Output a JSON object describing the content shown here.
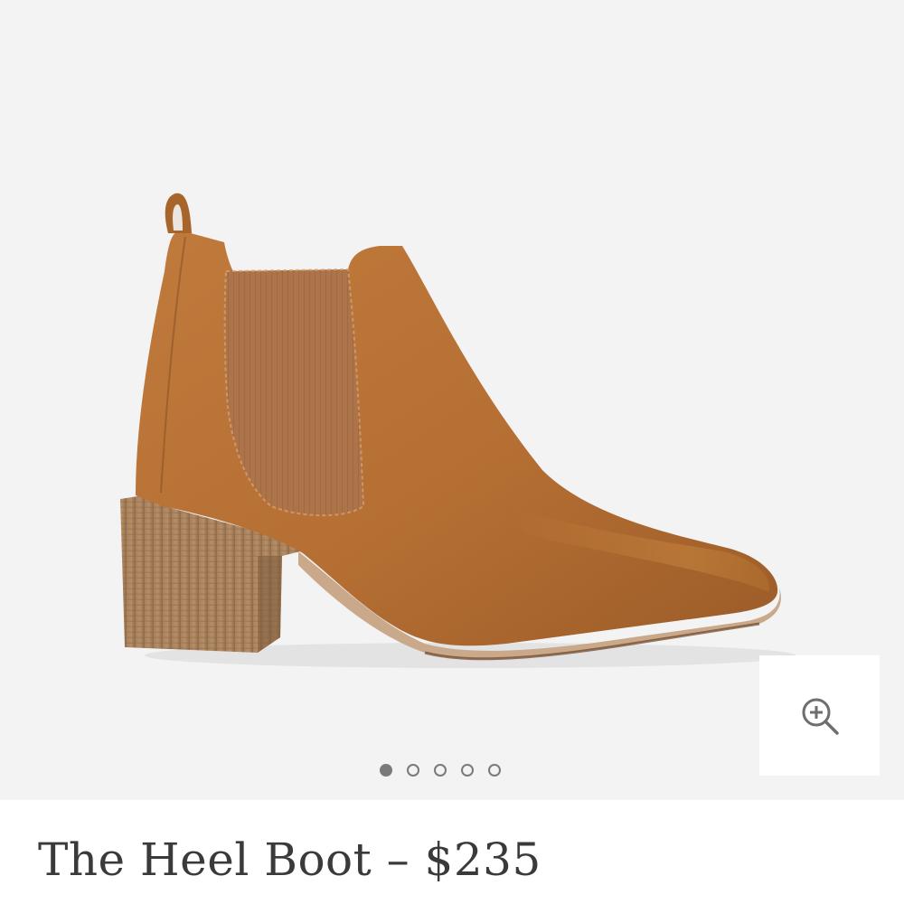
{
  "product": {
    "title": "The Heel Boot – $235",
    "image_subject": "tan-leather-chelsea-boot"
  },
  "gallery": {
    "total_images": 5,
    "active_index": 0,
    "zoom_icon": "zoom-in-icon"
  },
  "colors": {
    "leather": "#b46e35",
    "gallery_background": "#f3f3f4",
    "dot": "#7a7a7a",
    "title_text": "#3a3a3a"
  }
}
